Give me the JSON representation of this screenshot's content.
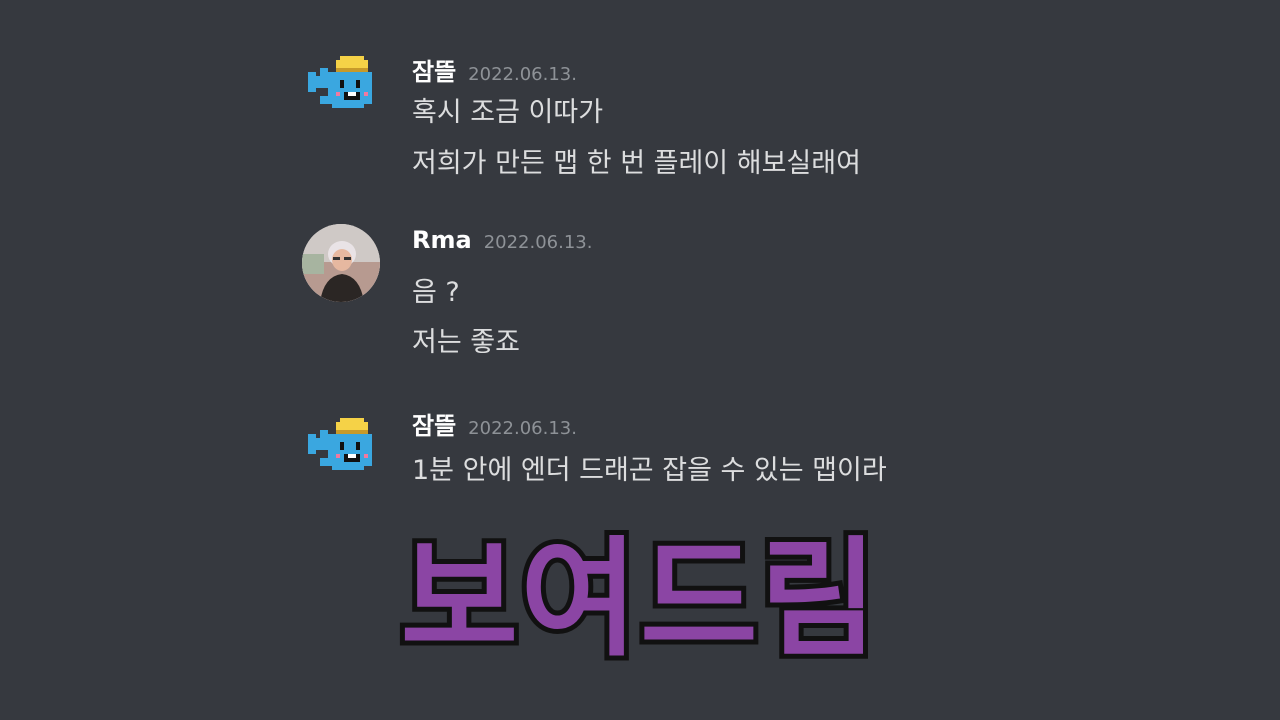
{
  "messages": [
    {
      "username": "잠뜰",
      "timestamp": "2022.06.13.",
      "avatar_icon": "blue-pixel-fish-avatar-icon",
      "lines": [
        "혹시 조금 이따가",
        "저희가 만든 맵 한 번 플레이 해보실래여"
      ]
    },
    {
      "username": "Rma",
      "timestamp": "2022.06.13.",
      "avatar_icon": "user-photo-avatar",
      "lines": [
        "음 ?",
        "저는 좋죠"
      ]
    },
    {
      "username": "잠뜰",
      "timestamp": "2022.06.13.",
      "avatar_icon": "blue-pixel-fish-avatar-icon",
      "lines": [
        "1분 안에 엔더 드래곤 잡을 수 있는 맵이라"
      ]
    }
  ],
  "caption": "보여드림",
  "colors": {
    "background": "#36393f",
    "username": "#ffffff",
    "timestamp": "#8e9297",
    "message_text": "#dcddde",
    "caption_fill": "#8b45a4",
    "caption_outline": "#111111"
  }
}
